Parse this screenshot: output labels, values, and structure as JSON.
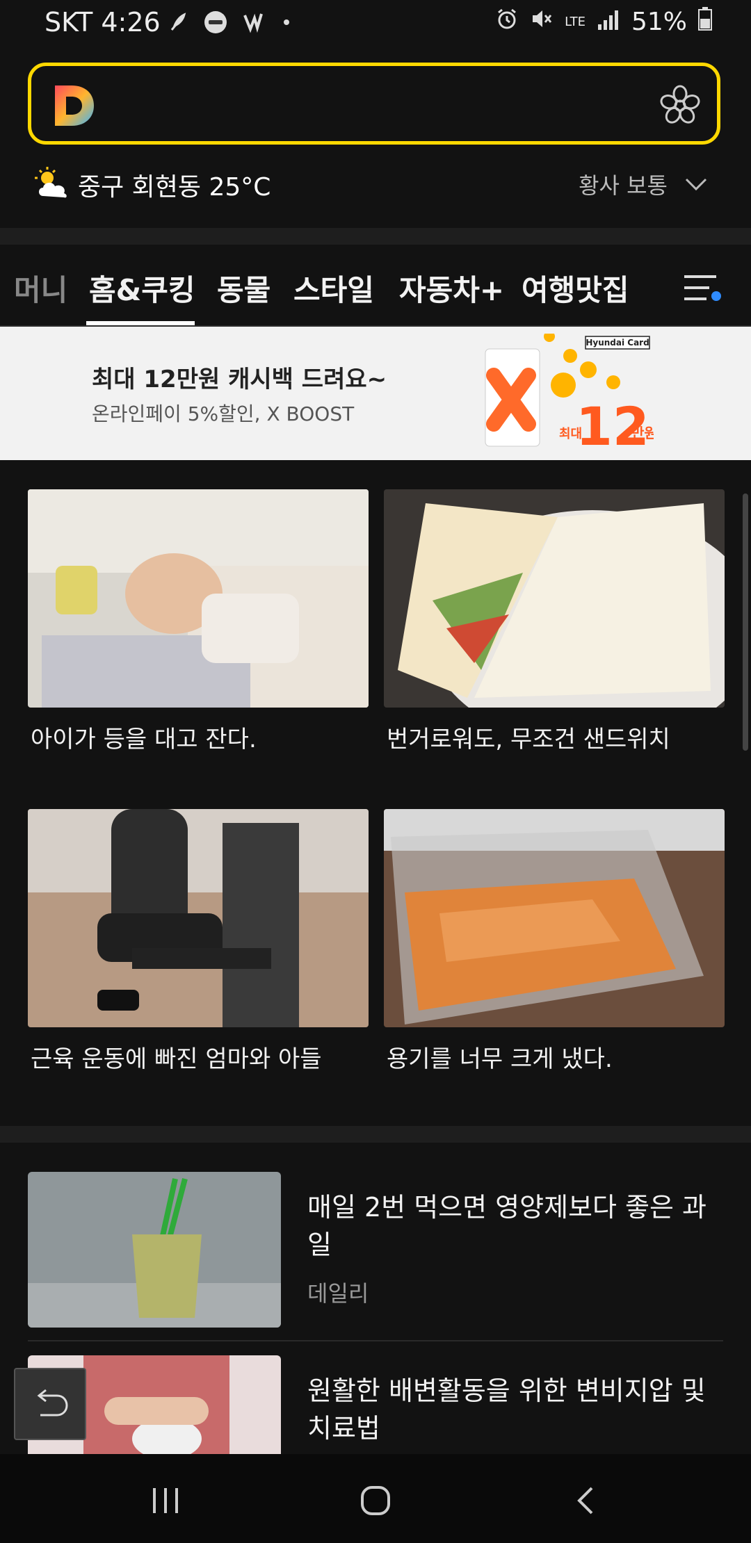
{
  "status_bar": {
    "carrier_time": "SKT 4:26",
    "network": "LTE",
    "battery": "51%"
  },
  "search": {
    "logo_letter": "D"
  },
  "weather": {
    "location_temp": "중구 회현동 25°C",
    "dust": "황사 보통"
  },
  "tabs": [
    {
      "label": "머니",
      "state": "dim"
    },
    {
      "label": "홈&쿠킹",
      "state": "active"
    },
    {
      "label": "동물",
      "state": "normal"
    },
    {
      "label": "스타일",
      "state": "normal"
    },
    {
      "label": "자동차+",
      "state": "normal"
    },
    {
      "label": "여행맛집",
      "state": "normal"
    }
  ],
  "banner": {
    "title": "최대 12만원 캐시백 드려요~",
    "subtitle": "온라인페이 5%할인, X BOOST",
    "card_brand": "Hyundai Card",
    "amount_prefix": "최대",
    "amount": "12",
    "amount_unit": "만원"
  },
  "grid": [
    {
      "caption": "아이가 등을 대고 잔다."
    },
    {
      "caption": "번거로워도, 무조건 샌드위치"
    },
    {
      "caption": "근육 운동에 빠진 엄마와 아들"
    },
    {
      "caption": "용기를 너무 크게 냈다."
    }
  ],
  "list": [
    {
      "title": "매일 2번 먹으면 영양제보다 좋은 과일",
      "source": "데일리"
    },
    {
      "title": "원활한 배변활동을 위한 변비지압 및 치료법",
      "source": ""
    }
  ],
  "colors": {
    "accent_yellow": "#ffd800",
    "background": "#121212",
    "notification_blue": "#2f8cff"
  }
}
